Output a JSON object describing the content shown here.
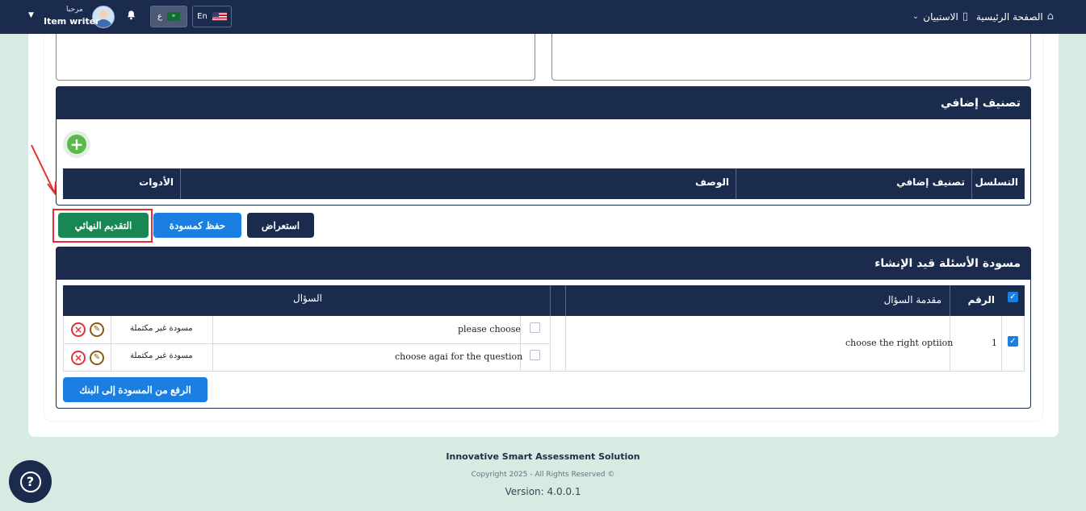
{
  "topbar": {
    "home": "الصفحة الرئيسية",
    "survey": "الاستبيان",
    "lang_en": "En",
    "lang_ar": "ع",
    "greeting": "مرحبا",
    "username": "Item writer"
  },
  "extra_panel": {
    "title": "تصنيف إضافي",
    "columns": [
      "التسلسل",
      "تصنيف إضافي",
      "الوصف",
      "الأدوات"
    ]
  },
  "actions": {
    "final_submit": "التقديم النهائي",
    "save_draft": "حفظ كمسودة",
    "preview": "استعراض"
  },
  "draft_panel": {
    "title": "مسودة الأسئلة قيد الإنشاء",
    "columns": {
      "number": "الرقم",
      "stem": "مقدمة السؤال",
      "question": "السؤال"
    },
    "rows": [
      {
        "number": "1",
        "stem": "choose the right optiion",
        "checked": true,
        "sub_items": [
          {
            "question": "please choose",
            "status": "مسودة غير مكتملة",
            "checked": false
          },
          {
            "question": "choose agai  for the question",
            "status": "مسودة غير مكتملة",
            "checked": false
          }
        ]
      }
    ],
    "upload_button": "الرفع من المسودة إلى البنك"
  },
  "footer": {
    "product": "Innovative Smart Assessment Solution",
    "copyright": "Copyright 2025 - All Rights Reserved ©",
    "version": "Version: 4.0.0.1"
  },
  "colors": {
    "navy": "#1b2b4d",
    "green": "#198754",
    "blue": "#1a7fe0",
    "highlight": "#e03030"
  }
}
